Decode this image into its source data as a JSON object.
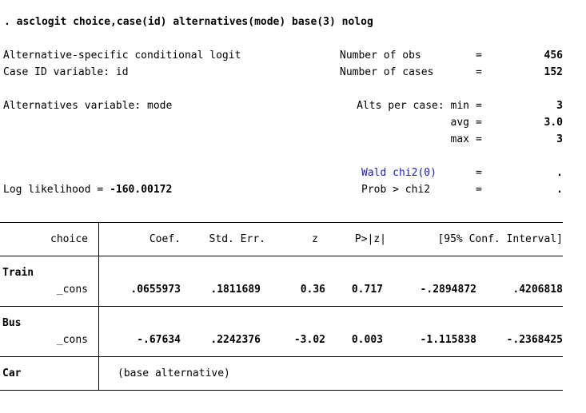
{
  "command": ". asclogit choice,case(id) alternatives(mode) base(3) nolog",
  "header": {
    "left": {
      "model_title": "Alternative-specific conditional logit",
      "case_id": "Case ID variable: id",
      "alternatives_var": "Alternatives variable: mode",
      "loglik_label": "Log likelihood = ",
      "loglik_value": "-160.00172"
    },
    "right": {
      "nobs_label": "Number of obs",
      "nobs_eq": "=",
      "nobs_value": "456",
      "ncases_label": "Number of cases",
      "ncases_eq": "=",
      "ncases_value": "152",
      "alts_min_label": "Alts per case: min",
      "alts_min_eq": "=",
      "alts_min_value": "3",
      "alts_avg_label": "avg",
      "alts_avg_eq": "=",
      "alts_avg_value": "3.0",
      "alts_max_label": "max",
      "alts_max_eq": "=",
      "alts_max_value": "3",
      "wald_label": "Wald chi2(0)",
      "wald_eq": "=",
      "wald_value": ".",
      "prob_label": "Prob > chi2",
      "prob_eq": "=",
      "prob_value": "."
    }
  },
  "table": {
    "columns": [
      "choice",
      "Coef.",
      "Std. Err.",
      "z",
      "P>|z|",
      "[95% Conf. Interval]"
    ],
    "groups": [
      {
        "name": "Train",
        "rows": [
          {
            "var": "_cons",
            "coef": ".0655973",
            "se": ".1811689",
            "z": "0.36",
            "p": "0.717",
            "ci_low": "-.2894872",
            "ci_high": ".4206818"
          }
        ]
      },
      {
        "name": "Bus",
        "rows": [
          {
            "var": "_cons",
            "coef": "-.67634",
            "se": ".2242376",
            "z": "-3.02",
            "p": "0.003",
            "ci_low": "-1.115838",
            "ci_high": "-.2368425"
          }
        ]
      },
      {
        "name": "Car",
        "note": "(base alternative)"
      }
    ]
  }
}
